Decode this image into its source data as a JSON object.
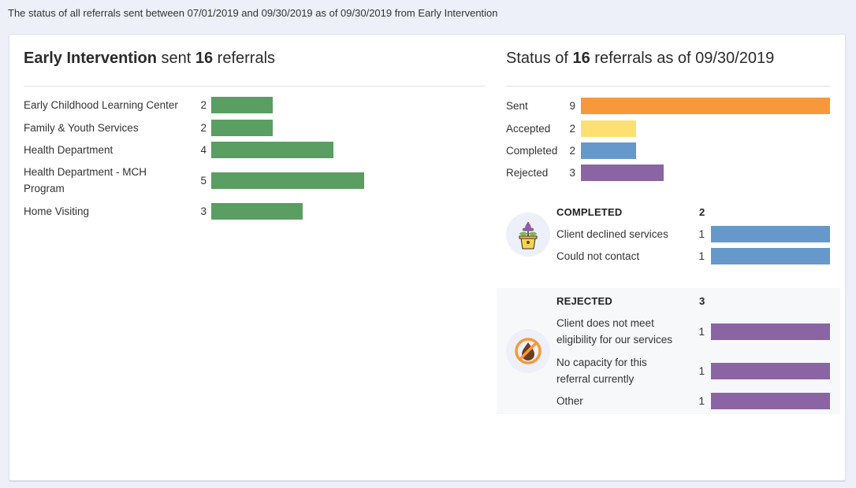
{
  "caption": "The status of all referrals sent between 07/01/2019 and 09/30/2019 as of 09/30/2019 from Early Intervention",
  "left_panel": {
    "title": {
      "org": "Early Intervention",
      "mid": " sent ",
      "count": "16",
      "tail": " referrals"
    },
    "bar_color": "#5a9e62",
    "max_value": 5,
    "items": [
      {
        "label": "Early Childhood Learning Center",
        "value": 2
      },
      {
        "label": "Family & Youth Services",
        "value": 2
      },
      {
        "label": "Health Department",
        "value": 4
      },
      {
        "label": "Health Department - MCH Program",
        "value": 5
      },
      {
        "label": "Home Visiting",
        "value": 3
      }
    ]
  },
  "right_panel": {
    "title": {
      "pre": "Status of ",
      "count": "16",
      "tail": " referrals as of 09/30/2019"
    },
    "max_value": 9,
    "statuses": [
      {
        "label": "Sent",
        "value": 9,
        "color": "#f7993a"
      },
      {
        "label": "Accepted",
        "value": 2,
        "color": "#fce172"
      },
      {
        "label": "Completed",
        "value": 2,
        "color": "#6699c9"
      },
      {
        "label": "Rejected",
        "value": 3,
        "color": "#8b65a3"
      }
    ],
    "completed": {
      "heading": "COMPLETED",
      "count": "2",
      "icon": "plant-pot-icon",
      "color": "#6699c9",
      "max_value": 1,
      "reasons": [
        {
          "label": "Client declined services",
          "value": 1
        },
        {
          "label": "Could not contact",
          "value": 1
        }
      ]
    },
    "rejected": {
      "heading": "REJECTED",
      "count": "3",
      "icon": "no-water-icon",
      "color": "#8b65a3",
      "max_value": 1,
      "reasons": [
        {
          "label": "Client does not meet eligibility for our services",
          "value": 1
        },
        {
          "label": "No capacity for this referral currently",
          "value": 1
        },
        {
          "label": "Other",
          "value": 1
        }
      ]
    }
  }
}
